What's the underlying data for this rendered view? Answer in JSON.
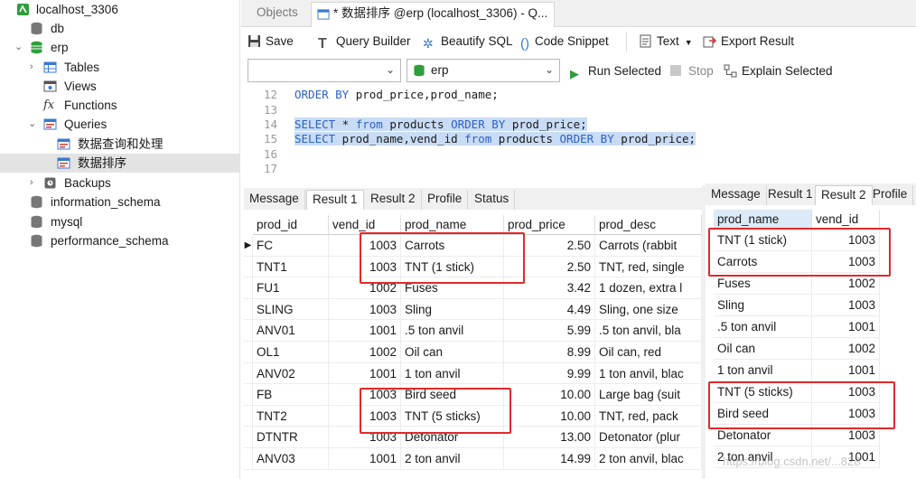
{
  "sidebar": {
    "connection": "localhost_3306",
    "items": [
      {
        "label": "db"
      },
      {
        "label": "erp"
      },
      {
        "label": "Tables"
      },
      {
        "label": "Views"
      },
      {
        "label": "Functions"
      },
      {
        "label": "Queries"
      },
      {
        "label": "数据查询和处理"
      },
      {
        "label": "数据排序"
      },
      {
        "label": "Backups"
      },
      {
        "label": "information_schema"
      },
      {
        "label": "mysql"
      },
      {
        "label": "performance_schema"
      }
    ]
  },
  "tabs": {
    "objects": "Objects",
    "query": "* 数据排序 @erp (localhost_3306) - Q..."
  },
  "toolbar": {
    "save": "Save",
    "query_builder": "Query Builder",
    "beautify": "Beautify SQL",
    "snippet": "Code Snippet",
    "text": "Text",
    "export": "Export Result"
  },
  "selectors": {
    "connection_value": "",
    "database_value": "erp",
    "run_selected": "Run Selected",
    "stop": "Stop",
    "explain_selected": "Explain Selected"
  },
  "editor": {
    "lines": [
      {
        "n": "12",
        "code": "ORDER BY prod_price,prod_name;"
      },
      {
        "n": "13",
        "code": ""
      },
      {
        "n": "14",
        "code": "SELECT * from products ORDER BY prod_price;"
      },
      {
        "n": "15",
        "code": "SELECT prod_name,vend_id from products ORDER BY prod_price;"
      },
      {
        "n": "16",
        "code": ""
      },
      {
        "n": "17",
        "code": ""
      }
    ]
  },
  "result_left": {
    "tabs": [
      "Message",
      "Result 1",
      "Result 2",
      "Profile",
      "Status"
    ],
    "columns": [
      "prod_id",
      "vend_id",
      "prod_name",
      "prod_price",
      "prod_desc"
    ],
    "rows": [
      [
        "FC",
        "1003",
        "Carrots",
        "2.50",
        "Carrots (rabbit"
      ],
      [
        "TNT1",
        "1003",
        "TNT (1 stick)",
        "2.50",
        "TNT, red, single"
      ],
      [
        "FU1",
        "1002",
        "Fuses",
        "3.42",
        "1 dozen, extra l"
      ],
      [
        "SLING",
        "1003",
        "Sling",
        "4.49",
        "Sling, one size"
      ],
      [
        "ANV01",
        "1001",
        ".5 ton anvil",
        "5.99",
        ".5 ton anvil, bla"
      ],
      [
        "OL1",
        "1002",
        "Oil can",
        "8.99",
        "Oil can, red"
      ],
      [
        "ANV02",
        "1001",
        "1 ton anvil",
        "9.99",
        "1 ton anvil, blac"
      ],
      [
        "FB",
        "1003",
        "Bird seed",
        "10.00",
        "Large bag (suit"
      ],
      [
        "TNT2",
        "1003",
        "TNT (5 sticks)",
        "10.00",
        "TNT, red, pack"
      ],
      [
        "DTNTR",
        "1003",
        "Detonator",
        "13.00",
        "Detonator (plur"
      ],
      [
        "ANV03",
        "1001",
        "2 ton anvil",
        "14.99",
        "2 ton anvil, blac"
      ]
    ]
  },
  "result_right": {
    "tabs": [
      "Message",
      "Result 1",
      "Result 2",
      "Profile"
    ],
    "columns": [
      "prod_name",
      "vend_id"
    ],
    "rows": [
      [
        "TNT (1 stick)",
        "1003"
      ],
      [
        "Carrots",
        "1003"
      ],
      [
        "Fuses",
        "1002"
      ],
      [
        "Sling",
        "1003"
      ],
      [
        ".5 ton anvil",
        "1001"
      ],
      [
        "Oil can",
        "1002"
      ],
      [
        "1 ton anvil",
        "1001"
      ],
      [
        "TNT (5 sticks)",
        "1003"
      ],
      [
        "Bird seed",
        "1003"
      ],
      [
        "Detonator",
        "1003"
      ],
      [
        "2 ton anvil",
        "1001"
      ]
    ]
  },
  "watermark": "https://blog.csdn.net/...828",
  "colors": {
    "keyword": "#2b61c8",
    "highlight": "#c9dcf5",
    "annotation": "#e02a2a",
    "db_icon": "#2e9e3a"
  }
}
